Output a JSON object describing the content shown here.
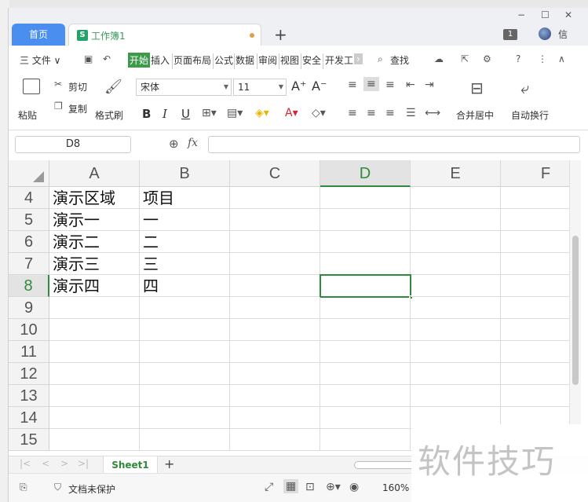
{
  "window": {
    "minimize": "−",
    "maximize": "☐",
    "close": "✕",
    "badge": "1",
    "user_label": "信"
  },
  "tabs": {
    "home": "首页",
    "doc_icon": "S",
    "doc_name": "工作簿1",
    "add": "+"
  },
  "menu": {
    "file": "三 文件 ∨",
    "items": [
      "开始",
      "插入",
      "页面布局",
      "公式",
      "数据",
      "审阅",
      "视图",
      "安全",
      "开发工"
    ],
    "search": "查找"
  },
  "ribbon": {
    "paste": "粘贴",
    "cut": "剪切",
    "copy": "复制",
    "format_painter": "格式刷",
    "font_name": "宋体",
    "font_size": "11",
    "bold": "B",
    "italic": "I",
    "underline": "U",
    "merge_center": "合并居中",
    "wrap_text": "自动换行"
  },
  "formula_bar": {
    "cell_ref": "D8",
    "fx": "fx",
    "value": ""
  },
  "grid": {
    "columns": [
      "A",
      "B",
      "C",
      "D",
      "E",
      "F"
    ],
    "selected_column": "D",
    "rows": [
      {
        "num": "4",
        "cells": [
          "演示区域",
          "项目",
          "",
          "",
          "",
          ""
        ]
      },
      {
        "num": "5",
        "cells": [
          "演示一",
          "一",
          "",
          "",
          "",
          ""
        ]
      },
      {
        "num": "6",
        "cells": [
          "演示二",
          "二",
          "",
          "",
          "",
          ""
        ]
      },
      {
        "num": "7",
        "cells": [
          "演示三",
          "三",
          "",
          "",
          "",
          ""
        ]
      },
      {
        "num": "8",
        "cells": [
          "演示四",
          "四",
          "",
          "",
          "",
          ""
        ]
      },
      {
        "num": "9",
        "cells": [
          "",
          "",
          "",
          "",
          "",
          ""
        ]
      },
      {
        "num": "10",
        "cells": [
          "",
          "",
          "",
          "",
          "",
          ""
        ]
      },
      {
        "num": "11",
        "cells": [
          "",
          "",
          "",
          "",
          "",
          ""
        ]
      },
      {
        "num": "12",
        "cells": [
          "",
          "",
          "",
          "",
          "",
          ""
        ]
      },
      {
        "num": "13",
        "cells": [
          "",
          "",
          "",
          "",
          "",
          ""
        ]
      },
      {
        "num": "14",
        "cells": [
          "",
          "",
          "",
          "",
          "",
          ""
        ]
      },
      {
        "num": "15",
        "cells": [
          "",
          "",
          "",
          "",
          "",
          ""
        ]
      }
    ],
    "selected_row": "8"
  },
  "sheets": {
    "active": "Sheet1",
    "add": "+"
  },
  "status": {
    "protection": "文档未保护",
    "zoom": "160%"
  },
  "watermark": "软件技巧",
  "colors": {
    "accent_green": "#2f8a3c",
    "home_tab_blue": "#4a8ef0"
  }
}
